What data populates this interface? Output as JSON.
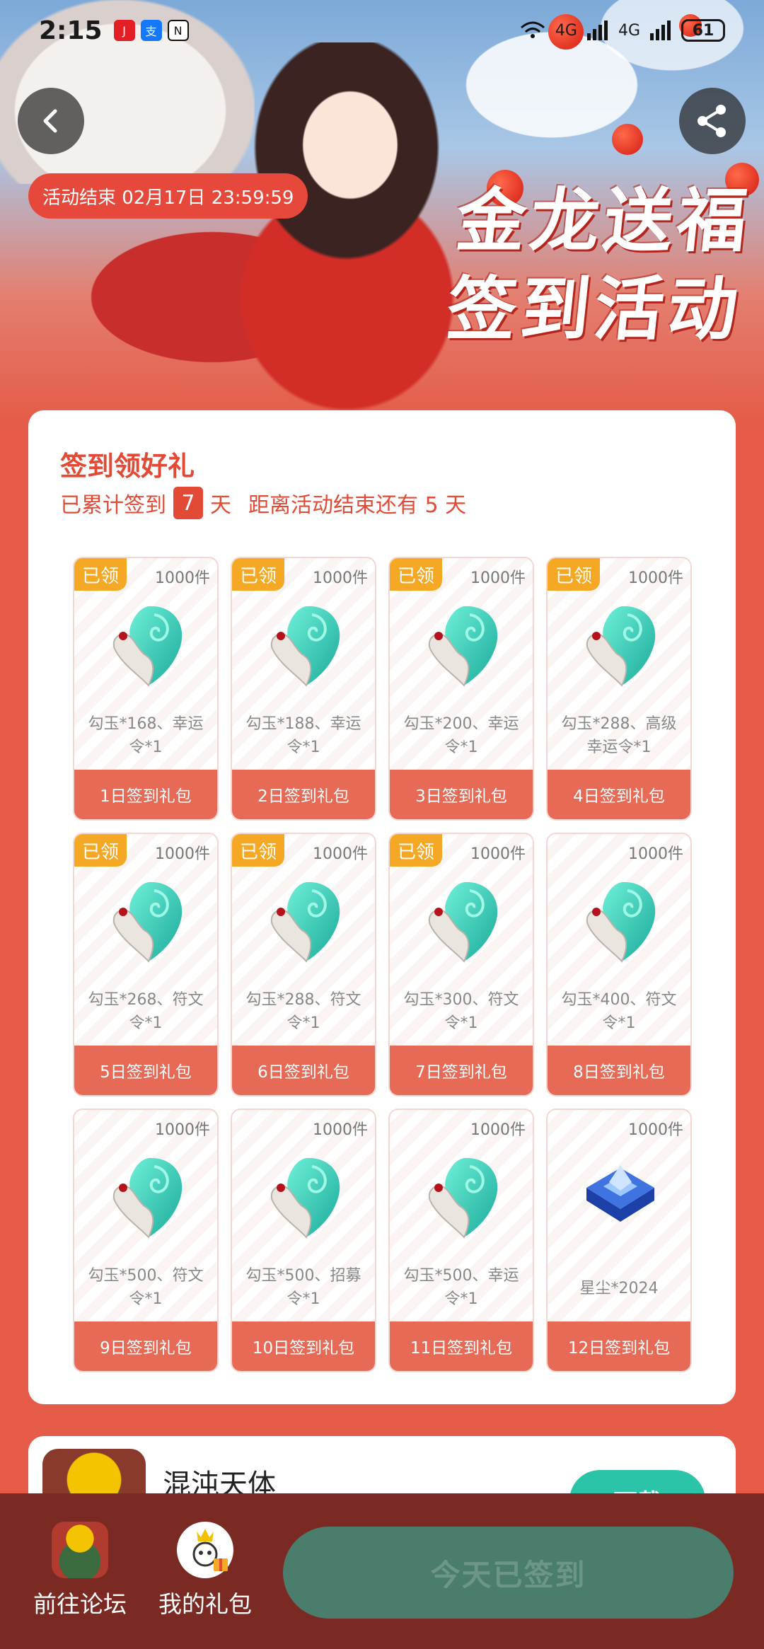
{
  "status_bar": {
    "time": "2:15",
    "network_labels": [
      "4G",
      "4G"
    ],
    "battery": "61"
  },
  "banner": {
    "title_line1": "金龙送福",
    "title_line2": "签到活动",
    "end_time": "活动结束 02月17日 23:59:59"
  },
  "signin": {
    "title": "签到领好礼",
    "cumulative_prefix": "已累计签到",
    "cumulative_days": "7",
    "cumulative_suffix": "天",
    "remaining_text": "距离活动结束还有 5 天",
    "claimed_label": "已领",
    "gifts": [
      {
        "stock": "1000件",
        "desc_line1": "勾玉*168、幸运",
        "desc_line2": "令*1",
        "label": "1日签到礼包",
        "claimed": true
      },
      {
        "stock": "1000件",
        "desc_line1": "勾玉*188、幸运",
        "desc_line2": "令*1",
        "label": "2日签到礼包",
        "claimed": true
      },
      {
        "stock": "1000件",
        "desc_line1": "勾玉*200、幸运",
        "desc_line2": "令*1",
        "label": "3日签到礼包",
        "claimed": true
      },
      {
        "stock": "1000件",
        "desc_line1": "勾玉*288、高级",
        "desc_line2": "幸运令*1",
        "label": "4日签到礼包",
        "claimed": true
      },
      {
        "stock": "1000件",
        "desc_line1": "勾玉*268、符文",
        "desc_line2": "令*1",
        "label": "5日签到礼包",
        "claimed": true
      },
      {
        "stock": "1000件",
        "desc_line1": "勾玉*288、符文",
        "desc_line2": "令*1",
        "label": "6日签到礼包",
        "claimed": true
      },
      {
        "stock": "1000件",
        "desc_line1": "勾玉*300、符文",
        "desc_line2": "令*1",
        "label": "7日签到礼包",
        "claimed": true
      },
      {
        "stock": "1000件",
        "desc_line1": "勾玉*400、符文",
        "desc_line2": "令*1",
        "label": "8日签到礼包",
        "claimed": false
      },
      {
        "stock": "1000件",
        "desc_line1": "勾玉*500、符文",
        "desc_line2": "令*1",
        "label": "9日签到礼包",
        "claimed": false
      },
      {
        "stock": "1000件",
        "desc_line1": "勾玉*500、招募",
        "desc_line2": "令*1",
        "label": "10日签到礼包",
        "claimed": false
      },
      {
        "stock": "1000件",
        "desc_line1": "勾玉*500、幸运",
        "desc_line2": "令*1",
        "label": "11日签到礼包",
        "claimed": false
      },
      {
        "stock": "1000件",
        "desc_line1": "星尘*2024",
        "desc_line2": "",
        "label": "12日签到礼包",
        "claimed": false
      }
    ]
  },
  "game": {
    "name": "混沌天体",
    "download_label": "下载"
  },
  "bottom_bar": {
    "forum_label": "前往论坛",
    "gifts_label": "我的礼包",
    "signed_label": "今天已签到"
  },
  "colors": {
    "accent": "#e34a35",
    "claimed_tag": "#f5a823",
    "signed_button": "#4a7d6c",
    "download_button": "#2bc4a9"
  }
}
